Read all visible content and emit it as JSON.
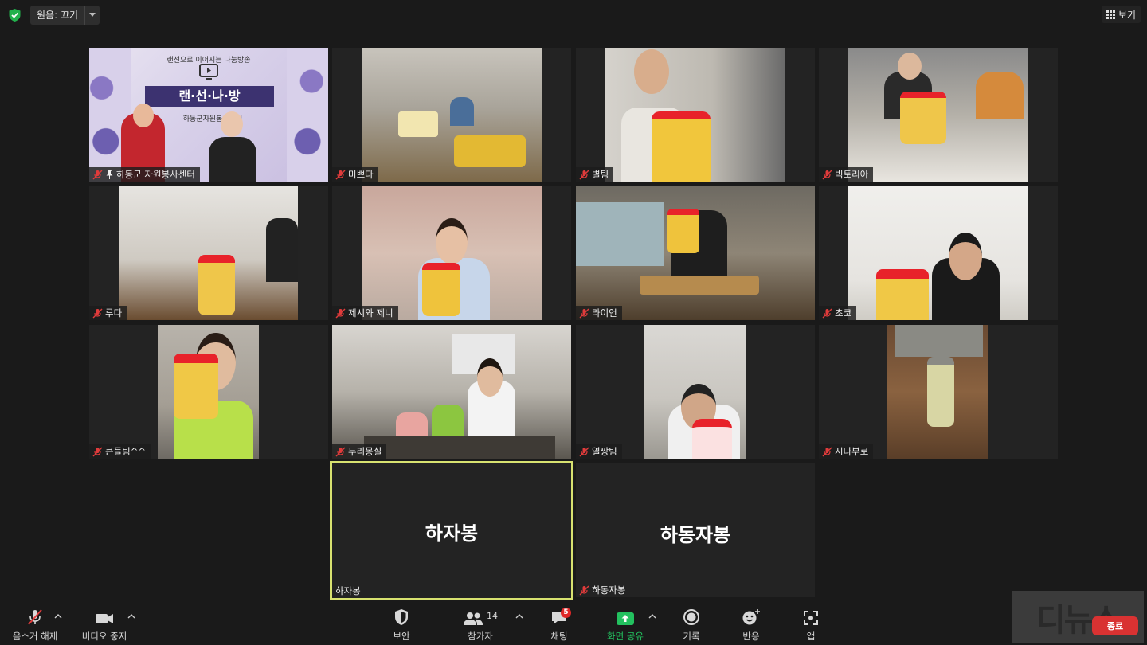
{
  "top": {
    "original_sound": "원음: 끄기",
    "view_label": "보기"
  },
  "tiles": [
    {
      "name": "하동군 자원봉사센터",
      "pinned": true
    },
    {
      "name": "미쁘다"
    },
    {
      "name": "별팀"
    },
    {
      "name": "빅토리아"
    },
    {
      "name": "루다"
    },
    {
      "name": "제시와 제니"
    },
    {
      "name": "라이언"
    },
    {
      "name": "초코"
    },
    {
      "name": "큰들팀^^"
    },
    {
      "name": "두리몽실"
    },
    {
      "name": "열짱팀"
    },
    {
      "name": "시나부로"
    },
    {
      "name": "하자봉",
      "big": "하자봉",
      "active": true
    },
    {
      "name": "하동자봉",
      "big": "하동자봉"
    }
  ],
  "toolbar": {
    "unmute": "음소거 해제",
    "stop_video": "비디오 중지",
    "security": "보안",
    "participants": "참가자",
    "participants_count": "14",
    "chat": "채팅",
    "chat_badge": "5",
    "share": "화면 공유",
    "record": "기록",
    "reactions": "반응",
    "apps": "앱",
    "end": "종료"
  },
  "banner": {
    "line1": "랜선으로 이어지는 나눔방송",
    "title": "랜·선·나·방",
    "line2": "하동군자원봉사센터"
  },
  "watermark": "디뉴스",
  "colors": {
    "background": "#1a1a1a",
    "tile_bg": "#232323",
    "active_border": "#d8e270",
    "share_green": "#23c15f",
    "end_red": "#d93232",
    "mute_red": "#e03b3b"
  }
}
